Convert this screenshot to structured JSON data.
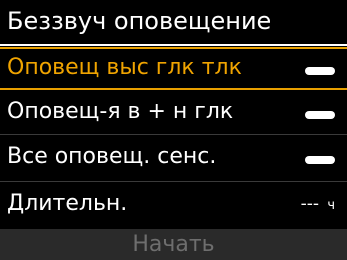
{
  "header": {
    "title": "Беззвуч оповещение"
  },
  "menu": {
    "items": [
      {
        "label": "Оповещ выс глк тлк",
        "control": "toggle",
        "selected": true
      },
      {
        "label": "Оповещ-я в + н глк",
        "control": "toggle",
        "selected": false
      },
      {
        "label": "Все оповещ. сенс.",
        "control": "toggle",
        "selected": false
      },
      {
        "label": "Длительн.",
        "control": "value",
        "value": "---",
        "unit": "ч",
        "selected": false
      }
    ]
  },
  "footer": {
    "start_label": "Начать"
  },
  "colors": {
    "background": "#000000",
    "text": "#ffffff",
    "selected_accent": "#f0a400",
    "disabled_text": "#6e6e6e",
    "footer_background": "#2a2a2a"
  }
}
